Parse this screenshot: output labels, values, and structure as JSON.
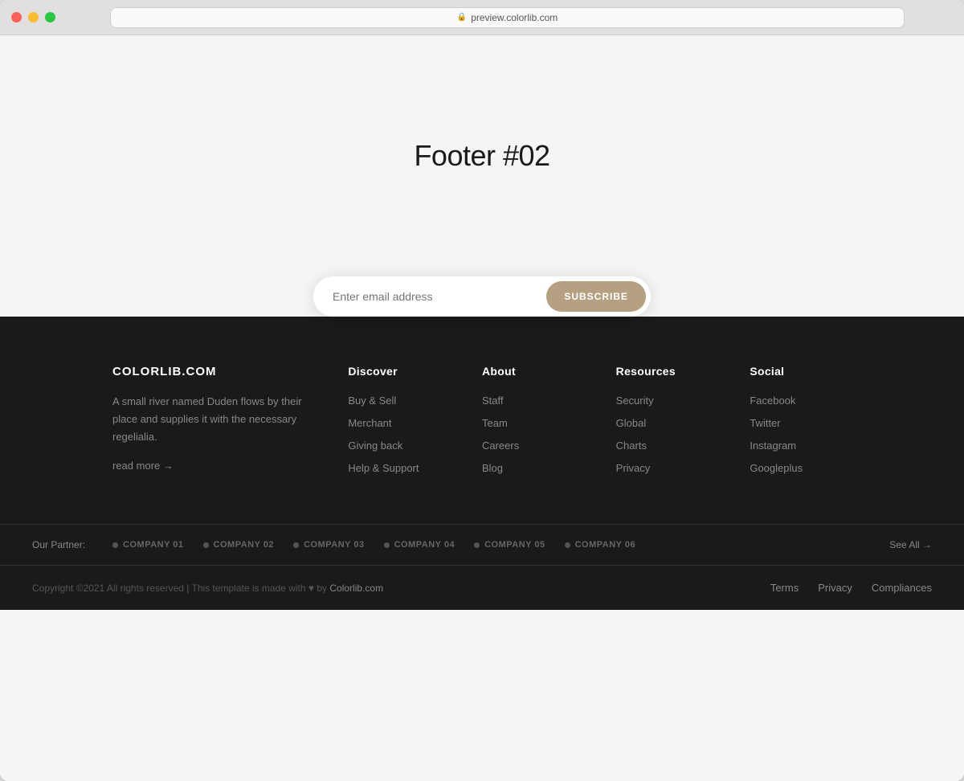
{
  "browser": {
    "url": "preview.colorlib.com",
    "tab_label": "preview.colorlib.com"
  },
  "hero": {
    "title": "Footer #02"
  },
  "subscribe": {
    "placeholder": "Enter email address",
    "button_label": "SUBSCRIBE"
  },
  "footer": {
    "brand": {
      "name": "COLORLIB.COM",
      "description": "A small river named Duden flows by their place and supplies it with the necessary regelialia.",
      "read_more": "read more →"
    },
    "columns": [
      {
        "heading": "Discover",
        "links": [
          "Buy & Sell",
          "Merchant",
          "Giving back",
          "Help & Support"
        ]
      },
      {
        "heading": "About",
        "links": [
          "Staff",
          "Team",
          "Careers",
          "Blog"
        ]
      },
      {
        "heading": "Resources",
        "links": [
          "Security",
          "Global",
          "Charts",
          "Privacy"
        ]
      },
      {
        "heading": "Social",
        "links": [
          "Facebook",
          "Twitter",
          "Instagram",
          "Googleplus"
        ]
      }
    ],
    "partners": {
      "label": "Our Partner:",
      "items": [
        "COMPANY 01",
        "COMPANY 02",
        "COMPANY 03",
        "COMPANY 04",
        "COMPANY 05",
        "COMPANY 06"
      ],
      "see_all": "See All →"
    },
    "copyright": "Copyright ©2021 All rights reserved | This template is made with ♥ by",
    "copyright_link": "Colorlib.com",
    "legal_links": [
      "Terms",
      "Privacy",
      "Compliances"
    ]
  }
}
